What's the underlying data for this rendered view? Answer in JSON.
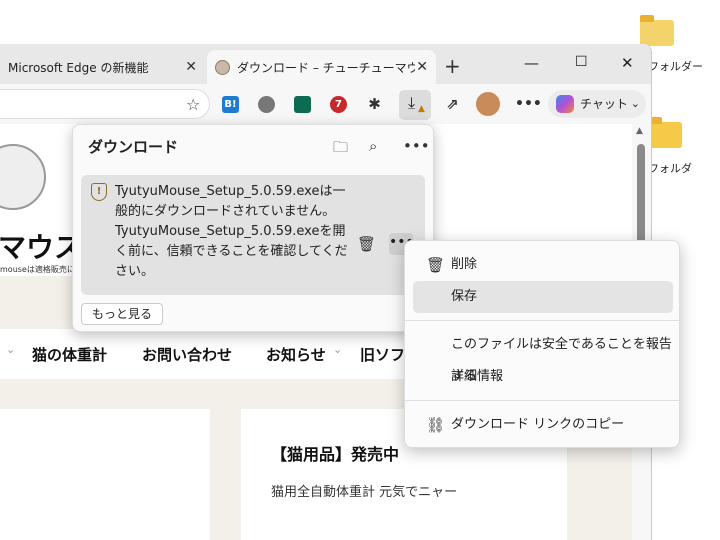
{
  "desktop": {
    "icons": [
      {
        "label": "フォルダー"
      },
      {
        "label": "フォルダ"
      }
    ]
  },
  "browser": {
    "tabs": [
      {
        "title": "Microsoft Edge の新機能"
      },
      {
        "title": "ダウンロード – チューチューマウスと仲間"
      }
    ],
    "toolbar": {
      "chat_label": "チャット",
      "ext_badge": "B!",
      "ext_count": "7"
    }
  },
  "page": {
    "site_title": "マウス",
    "site_sub": "mouseは適格販売に",
    "nav": [
      "猫の体重計",
      "お問い合わせ",
      "お知らせ",
      "旧ソフ"
    ],
    "card2": {
      "title": "【猫用品】発売中",
      "text": "猫用全自動体重計 元気でニャー"
    }
  },
  "downloads_panel": {
    "title": "ダウンロード",
    "item_message": "TyutyuMouse_Setup_5.0.59.exeは一般的にダウンロードされていません。TyutyuMouse_Setup_5.0.59.exeを開く前に、信頼できることを確認してください。",
    "see_more": "もっと見る"
  },
  "context_menu": {
    "items": [
      {
        "label": "削除",
        "icon": "trash-icon"
      },
      {
        "label": "保存",
        "icon": ""
      },
      {
        "label": "このファイルは安全であることを報告する",
        "icon": ""
      },
      {
        "label": "詳細情報",
        "icon": ""
      },
      {
        "label": "ダウンロード リンクのコピー",
        "icon": "link-icon"
      }
    ],
    "highlighted": "保存"
  },
  "colors": {
    "tab_bar": "#e8e8e8",
    "highlight": "#e4e4e4",
    "warning": "#8a6d2c"
  }
}
